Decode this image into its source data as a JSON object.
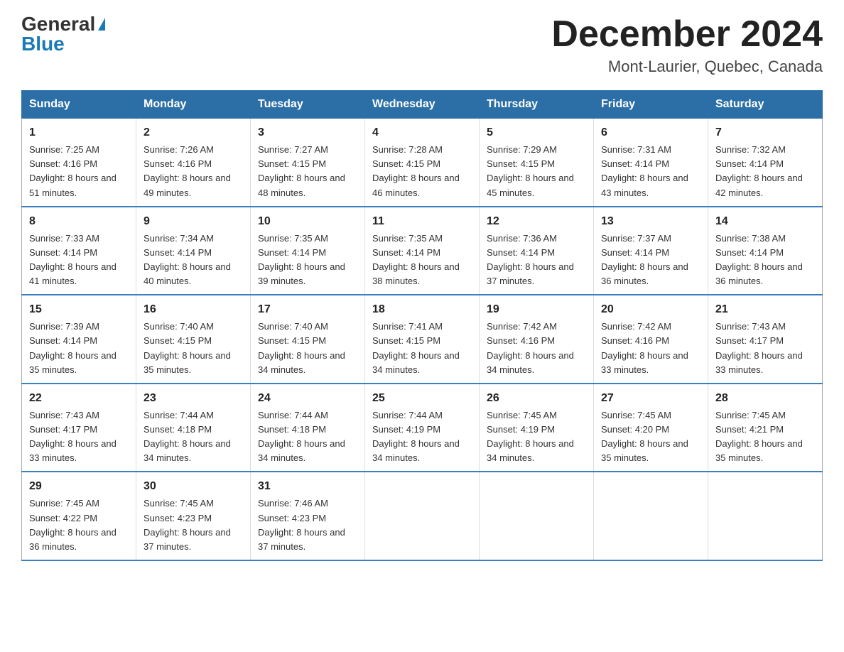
{
  "header": {
    "logo_general": "General",
    "logo_blue": "Blue",
    "month_title": "December 2024",
    "location": "Mont-Laurier, Quebec, Canada"
  },
  "weekdays": [
    "Sunday",
    "Monday",
    "Tuesday",
    "Wednesday",
    "Thursday",
    "Friday",
    "Saturday"
  ],
  "weeks": [
    [
      {
        "day": "1",
        "sunrise": "Sunrise: 7:25 AM",
        "sunset": "Sunset: 4:16 PM",
        "daylight": "Daylight: 8 hours and 51 minutes."
      },
      {
        "day": "2",
        "sunrise": "Sunrise: 7:26 AM",
        "sunset": "Sunset: 4:16 PM",
        "daylight": "Daylight: 8 hours and 49 minutes."
      },
      {
        "day": "3",
        "sunrise": "Sunrise: 7:27 AM",
        "sunset": "Sunset: 4:15 PM",
        "daylight": "Daylight: 8 hours and 48 minutes."
      },
      {
        "day": "4",
        "sunrise": "Sunrise: 7:28 AM",
        "sunset": "Sunset: 4:15 PM",
        "daylight": "Daylight: 8 hours and 46 minutes."
      },
      {
        "day": "5",
        "sunrise": "Sunrise: 7:29 AM",
        "sunset": "Sunset: 4:15 PM",
        "daylight": "Daylight: 8 hours and 45 minutes."
      },
      {
        "day": "6",
        "sunrise": "Sunrise: 7:31 AM",
        "sunset": "Sunset: 4:14 PM",
        "daylight": "Daylight: 8 hours and 43 minutes."
      },
      {
        "day": "7",
        "sunrise": "Sunrise: 7:32 AM",
        "sunset": "Sunset: 4:14 PM",
        "daylight": "Daylight: 8 hours and 42 minutes."
      }
    ],
    [
      {
        "day": "8",
        "sunrise": "Sunrise: 7:33 AM",
        "sunset": "Sunset: 4:14 PM",
        "daylight": "Daylight: 8 hours and 41 minutes."
      },
      {
        "day": "9",
        "sunrise": "Sunrise: 7:34 AM",
        "sunset": "Sunset: 4:14 PM",
        "daylight": "Daylight: 8 hours and 40 minutes."
      },
      {
        "day": "10",
        "sunrise": "Sunrise: 7:35 AM",
        "sunset": "Sunset: 4:14 PM",
        "daylight": "Daylight: 8 hours and 39 minutes."
      },
      {
        "day": "11",
        "sunrise": "Sunrise: 7:35 AM",
        "sunset": "Sunset: 4:14 PM",
        "daylight": "Daylight: 8 hours and 38 minutes."
      },
      {
        "day": "12",
        "sunrise": "Sunrise: 7:36 AM",
        "sunset": "Sunset: 4:14 PM",
        "daylight": "Daylight: 8 hours and 37 minutes."
      },
      {
        "day": "13",
        "sunrise": "Sunrise: 7:37 AM",
        "sunset": "Sunset: 4:14 PM",
        "daylight": "Daylight: 8 hours and 36 minutes."
      },
      {
        "day": "14",
        "sunrise": "Sunrise: 7:38 AM",
        "sunset": "Sunset: 4:14 PM",
        "daylight": "Daylight: 8 hours and 36 minutes."
      }
    ],
    [
      {
        "day": "15",
        "sunrise": "Sunrise: 7:39 AM",
        "sunset": "Sunset: 4:14 PM",
        "daylight": "Daylight: 8 hours and 35 minutes."
      },
      {
        "day": "16",
        "sunrise": "Sunrise: 7:40 AM",
        "sunset": "Sunset: 4:15 PM",
        "daylight": "Daylight: 8 hours and 35 minutes."
      },
      {
        "day": "17",
        "sunrise": "Sunrise: 7:40 AM",
        "sunset": "Sunset: 4:15 PM",
        "daylight": "Daylight: 8 hours and 34 minutes."
      },
      {
        "day": "18",
        "sunrise": "Sunrise: 7:41 AM",
        "sunset": "Sunset: 4:15 PM",
        "daylight": "Daylight: 8 hours and 34 minutes."
      },
      {
        "day": "19",
        "sunrise": "Sunrise: 7:42 AM",
        "sunset": "Sunset: 4:16 PM",
        "daylight": "Daylight: 8 hours and 34 minutes."
      },
      {
        "day": "20",
        "sunrise": "Sunrise: 7:42 AM",
        "sunset": "Sunset: 4:16 PM",
        "daylight": "Daylight: 8 hours and 33 minutes."
      },
      {
        "day": "21",
        "sunrise": "Sunrise: 7:43 AM",
        "sunset": "Sunset: 4:17 PM",
        "daylight": "Daylight: 8 hours and 33 minutes."
      }
    ],
    [
      {
        "day": "22",
        "sunrise": "Sunrise: 7:43 AM",
        "sunset": "Sunset: 4:17 PM",
        "daylight": "Daylight: 8 hours and 33 minutes."
      },
      {
        "day": "23",
        "sunrise": "Sunrise: 7:44 AM",
        "sunset": "Sunset: 4:18 PM",
        "daylight": "Daylight: 8 hours and 34 minutes."
      },
      {
        "day": "24",
        "sunrise": "Sunrise: 7:44 AM",
        "sunset": "Sunset: 4:18 PM",
        "daylight": "Daylight: 8 hours and 34 minutes."
      },
      {
        "day": "25",
        "sunrise": "Sunrise: 7:44 AM",
        "sunset": "Sunset: 4:19 PM",
        "daylight": "Daylight: 8 hours and 34 minutes."
      },
      {
        "day": "26",
        "sunrise": "Sunrise: 7:45 AM",
        "sunset": "Sunset: 4:19 PM",
        "daylight": "Daylight: 8 hours and 34 minutes."
      },
      {
        "day": "27",
        "sunrise": "Sunrise: 7:45 AM",
        "sunset": "Sunset: 4:20 PM",
        "daylight": "Daylight: 8 hours and 35 minutes."
      },
      {
        "day": "28",
        "sunrise": "Sunrise: 7:45 AM",
        "sunset": "Sunset: 4:21 PM",
        "daylight": "Daylight: 8 hours and 35 minutes."
      }
    ],
    [
      {
        "day": "29",
        "sunrise": "Sunrise: 7:45 AM",
        "sunset": "Sunset: 4:22 PM",
        "daylight": "Daylight: 8 hours and 36 minutes."
      },
      {
        "day": "30",
        "sunrise": "Sunrise: 7:45 AM",
        "sunset": "Sunset: 4:23 PM",
        "daylight": "Daylight: 8 hours and 37 minutes."
      },
      {
        "day": "31",
        "sunrise": "Sunrise: 7:46 AM",
        "sunset": "Sunset: 4:23 PM",
        "daylight": "Daylight: 8 hours and 37 minutes."
      },
      null,
      null,
      null,
      null
    ]
  ]
}
